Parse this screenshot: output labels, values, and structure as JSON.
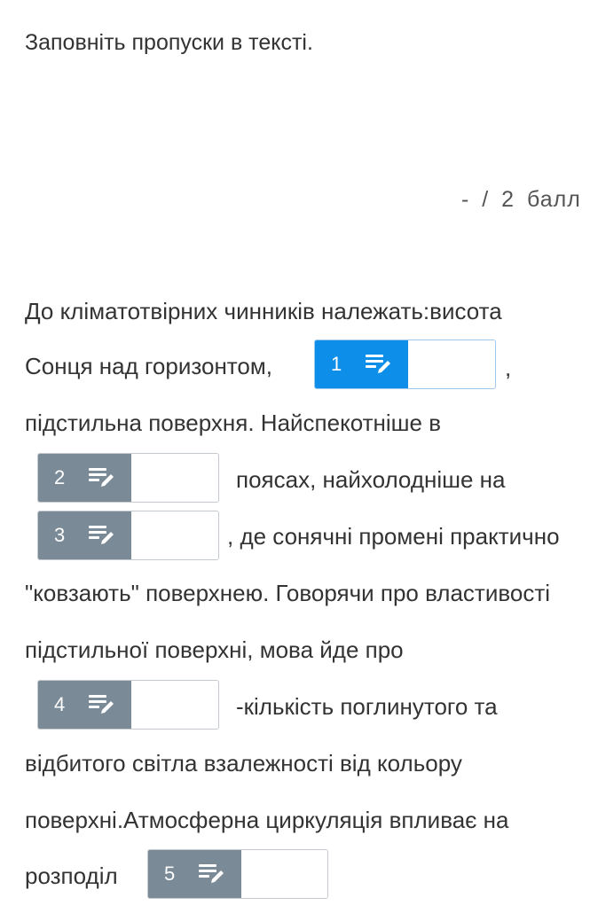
{
  "instruction": "Заповніть пропуски в тексті.",
  "score": "- / 2 балл",
  "text": {
    "l1": "До кліматотвірних чинників належать:висота",
    "l2": "Сонця над горизонтом,",
    "l2_tail": ",",
    "l3": "підстильна поверхня. Найспекотніше в",
    "l4": "поясах, найхолодніше на",
    "l5": ", де сонячні промені практично",
    "l6": "\"ковзають\" поверхнею. Говорячи про властивості",
    "l7": "підстильної поверхні, мова йде про",
    "l8": "-кількість поглинутого та",
    "l9": "відбитого світла взалежності від кольору",
    "l10": "поверхні.Атмосферна циркуляція впливає на",
    "l11": "розподіл"
  },
  "blanks": [
    {
      "number": "1",
      "value": "",
      "state": "active"
    },
    {
      "number": "2",
      "value": ""
    },
    {
      "number": "3",
      "value": ""
    },
    {
      "number": "4",
      "value": ""
    },
    {
      "number": "5",
      "value": ""
    }
  ],
  "icons": {
    "blank_icon": "list-edit-icon"
  },
  "colors": {
    "active_tag": "#0d8fe9",
    "inactive_tag": "#7a8a97",
    "text": "#333333"
  }
}
